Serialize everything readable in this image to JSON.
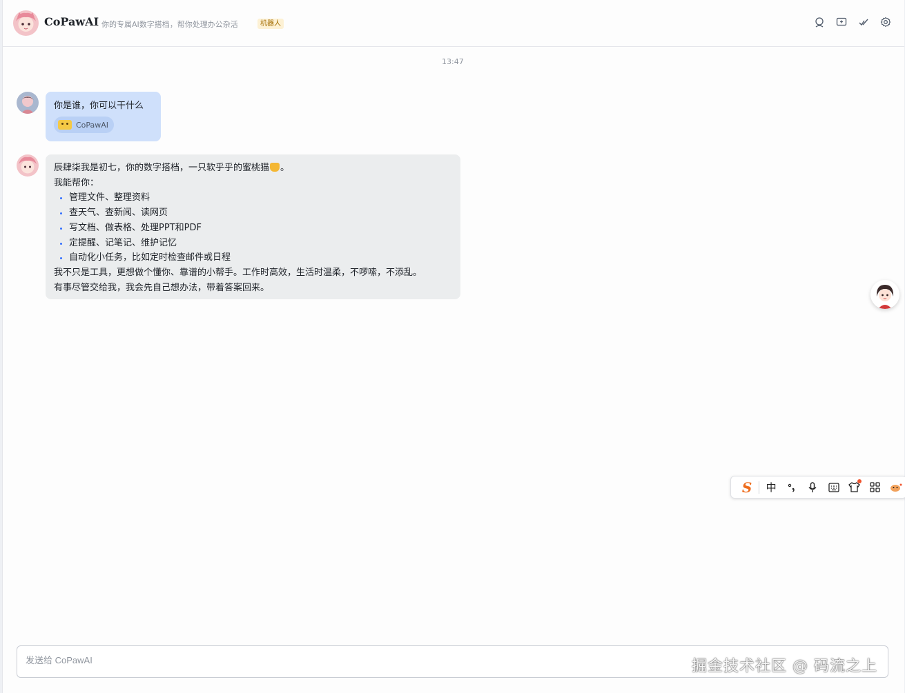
{
  "header": {
    "bot_name": "CoPawAI",
    "bot_description": "你的专属AI数字搭档，帮你处理办公杂活",
    "bot_tag": "机器人",
    "actions": [
      "search-icon",
      "add-chat-icon",
      "check-icon",
      "settings-icon"
    ]
  },
  "conversation": {
    "timestamp": "13:47",
    "user_message": {
      "text": "你是谁，你可以干什么",
      "mention": "CoPawAI"
    },
    "bot_message": {
      "line1_before": "辰肆柒我是初七，你的数字搭档，一只软乎乎的蜜桃猫",
      "line1_after": "。",
      "line2": "我能帮你：",
      "items": [
        "管理文件、整理资料",
        "查天气、查新闻、读网页",
        "写文档、做表格、处理PPT和PDF",
        "定提醒、记笔记、维护记忆",
        "自动化小任务，比如定时检查邮件或日程"
      ],
      "line3": "我不只是工具，更想做个懂你、靠谱的小帮手。工作时高效，生活时温柔，不啰嗦，不添乱。",
      "line4": "有事尽管交给我，我会先自己想办法，带着答案回来。"
    }
  },
  "ime_toolbar": {
    "logo": "S",
    "mode": "中",
    "items": [
      "punctuation-icon",
      "mic-icon",
      "keyboard-icon",
      "skin-icon",
      "apps-icon",
      "mascot-icon"
    ]
  },
  "composer": {
    "placeholder": "发送给 CoPawAI"
  },
  "watermark": "掘金技术社区 @ 码流之上",
  "colors": {
    "user_bubble": "#cfe0fb",
    "bot_bubble": "#ebedee",
    "accent": "#3370ff"
  }
}
